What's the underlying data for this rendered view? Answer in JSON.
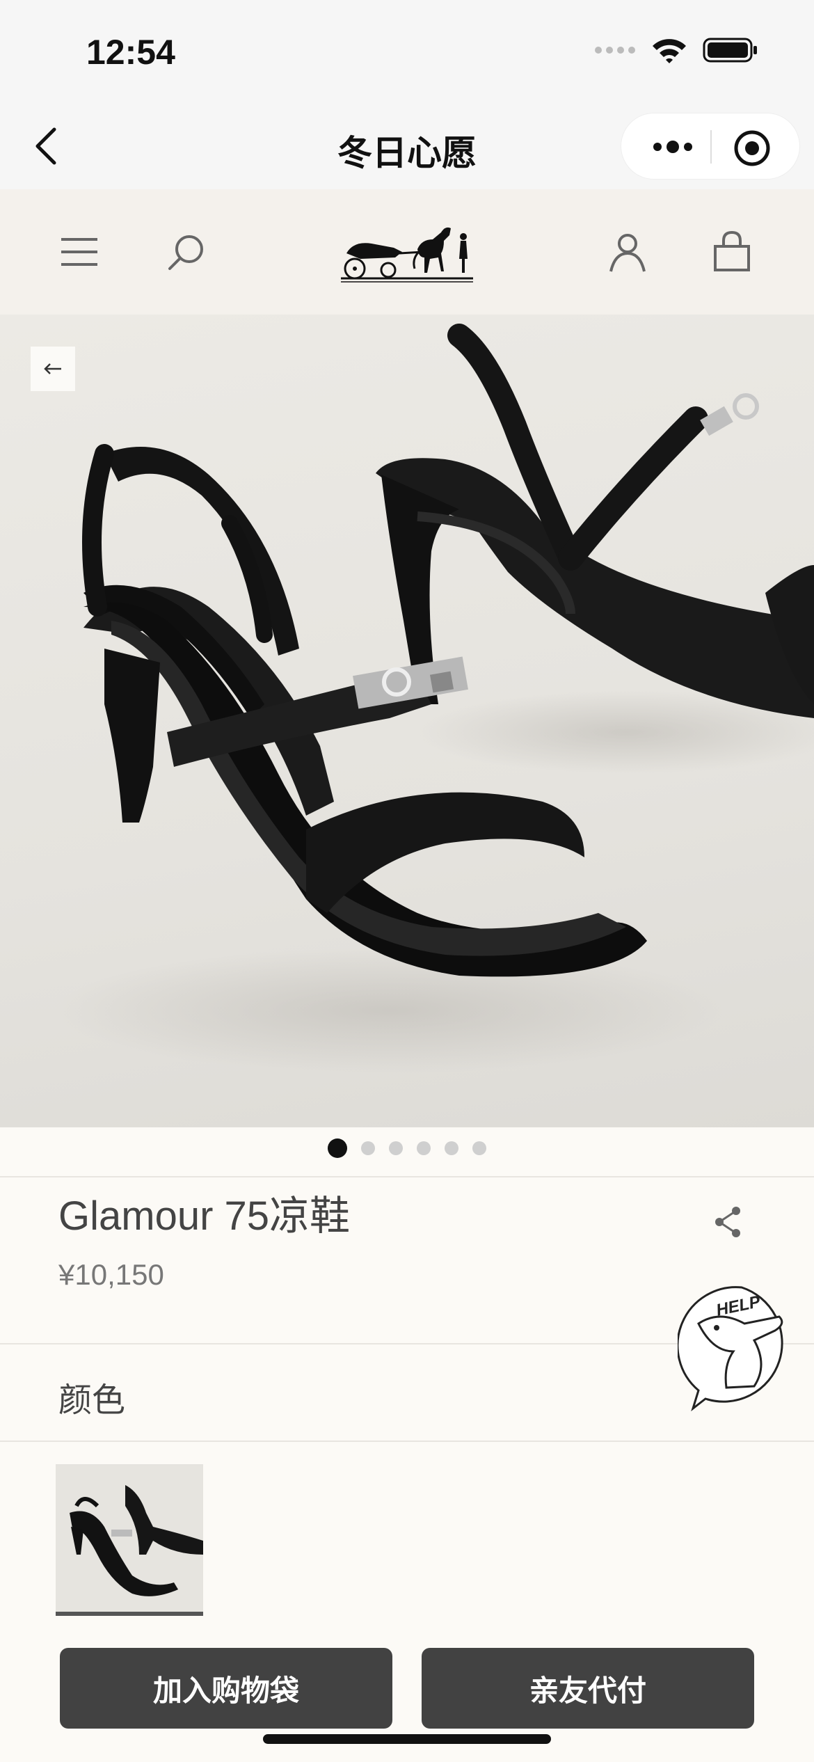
{
  "status_bar": {
    "time": "12:54",
    "icons": [
      "signal-icon",
      "wifi-icon",
      "battery-icon"
    ]
  },
  "nav": {
    "title": "冬日心愿",
    "back_icon": "chevron-left-icon",
    "capsule_icons": [
      "more-icon",
      "close-target-icon"
    ]
  },
  "site_header": {
    "icons": [
      "menu-icon",
      "search-icon",
      "brand-logo",
      "account-icon",
      "shopping-bag-icon"
    ]
  },
  "gallery": {
    "back_icon": "arrow-left-icon",
    "slide_count": 6,
    "active_index": 0
  },
  "product": {
    "title": "Glamour 75凉鞋",
    "price": "¥10,150",
    "share_icon": "share-icon"
  },
  "help": {
    "label": "HELP"
  },
  "color_section": {
    "label": "颜色"
  },
  "actions": {
    "add_to_cart": "加入购物袋",
    "friend_pay": "亲友代付"
  },
  "colors": {
    "button_bg": "#424242",
    "page_bg": "#fcfaf6",
    "header_bg": "#f4f1ec"
  }
}
